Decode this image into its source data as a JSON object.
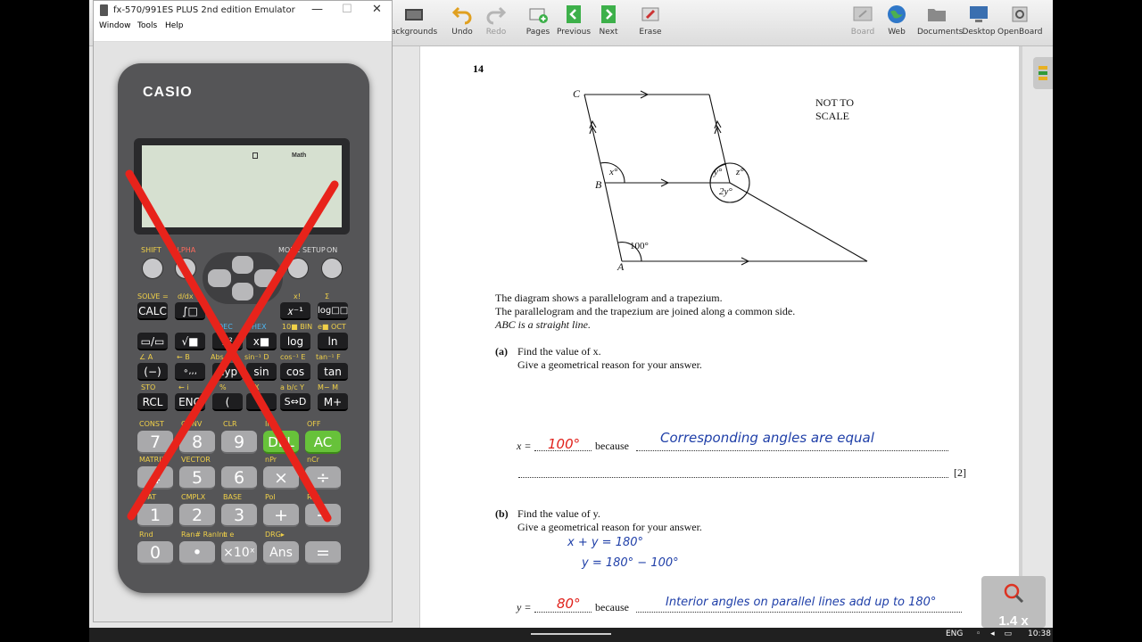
{
  "toolbar": {
    "left_items": [
      {
        "label": "ackgrounds",
        "icon": "backgrounds-icon"
      },
      {
        "label": "Undo",
        "icon": "undo-icon"
      },
      {
        "label": "Redo",
        "icon": "redo-icon"
      },
      {
        "label": "Pages",
        "icon": "pages-icon"
      },
      {
        "label": "Previous",
        "icon": "previous-icon"
      },
      {
        "label": "Next",
        "icon": "next-icon"
      },
      {
        "label": "Erase",
        "icon": "erase-icon"
      }
    ],
    "right_items": [
      {
        "label": "Board",
        "icon": "board-icon"
      },
      {
        "label": "Web",
        "icon": "web-icon"
      },
      {
        "label": "Documents",
        "icon": "documents-icon"
      },
      {
        "label": "Desktop",
        "icon": "desktop-icon"
      },
      {
        "label": "OpenBoard",
        "icon": "openboard-icon"
      }
    ]
  },
  "emulator": {
    "title": "fx-570/991ES PLUS 2nd edition Emulator",
    "menu": [
      "Window",
      "Tools",
      "Help"
    ],
    "brand": "CASIO",
    "lcd_indicator": "Math",
    "top_labels": {
      "shift": "SHIFT",
      "alpha": "ALPHA",
      "mode": "MODE SETUP",
      "on": "ON"
    },
    "row1_keys": [
      "CALC",
      "∫□",
      "",
      "",
      "𝑥⁻¹",
      "log□□"
    ],
    "row1_labels": [
      "SOLVE =",
      "d/dx",
      "",
      "",
      "x!",
      "Σ"
    ],
    "row2_keys": [
      "▭/▭",
      "√■",
      "x²",
      "",
      "x■",
      "log",
      "ln"
    ],
    "row2_labels": [
      "",
      "",
      "DEC",
      "HEX",
      "10■ BIN",
      "e■ OCT"
    ],
    "row3_keys": [
      "(−)",
      "∘,,,",
      "hyp",
      "sin",
      "cos",
      "tan"
    ],
    "row3_labels": [
      "∠ A",
      "← B",
      "Abs C",
      "sin⁻¹ D",
      "cos⁻¹ E",
      "tan⁻¹ F"
    ],
    "row4_keys": [
      "RCL",
      "ENG",
      "(",
      ")",
      "S⇔D",
      "M+"
    ],
    "row4_labels": [
      "STO",
      "← i",
      "%",
      ", X",
      "a b/c Y",
      "M− M"
    ],
    "num_rows": [
      {
        "labels": [
          "CONST",
          "CONV",
          "CLR",
          "INS",
          "OFF"
        ],
        "keys": [
          "7",
          "8",
          "9",
          "DEL",
          "AC"
        ]
      },
      {
        "labels": [
          "MATRIX",
          "VECTOR",
          "",
          "nPr",
          "nCr"
        ],
        "keys": [
          "4",
          "5",
          "6",
          "×",
          "÷"
        ]
      },
      {
        "labels": [
          "STAT",
          "CMPLX",
          "BASE",
          "Pol",
          "Rec"
        ],
        "keys": [
          "1",
          "2",
          "3",
          "+",
          "−"
        ]
      },
      {
        "labels": [
          "Rnd",
          "Ran# RanInt",
          "π e",
          "DRG▸",
          ""
        ],
        "keys": [
          "0",
          "•",
          "×10ˣ",
          "Ans",
          "="
        ]
      }
    ]
  },
  "paper": {
    "question_number": "14",
    "not_to_scale": [
      "NOT TO",
      "SCALE"
    ],
    "labels": {
      "c": "C",
      "b": "B",
      "a": "A",
      "x": "x°",
      "y": "y°",
      "z": "z°",
      "two_y": "2y°",
      "hundred": "100°"
    },
    "intro": [
      "The diagram shows a parallelogram and a trapezium.",
      "The parallelogram and the trapezium are joined along a common side.",
      "ABC is a straight line."
    ],
    "part_a": {
      "tag": "(a)",
      "lines": [
        "Find the value of x.",
        "Give a geometrical reason for your answer."
      ],
      "answer_prefix": "x = ",
      "answer_value": "100°",
      "because": "because",
      "reason": "Corresponding angles are equal",
      "marks": "[2]"
    },
    "part_b": {
      "tag": "(b)",
      "lines": [
        "Find the value of y.",
        "Give a geometrical reason for your answer."
      ],
      "working": [
        "x + y = 180°",
        "y = 180° − 100°"
      ],
      "answer_prefix": "y = ",
      "answer_value": "80°",
      "because": "because",
      "reason": "Interior angles on parallel lines add up to 180°"
    }
  },
  "zoom": "1.4 x",
  "taskbar": {
    "lang": "ENG",
    "time": "10:38"
  },
  "colors": {
    "pen_blue": "#1f3fa8",
    "pen_red": "#e0201a",
    "cross_red": "#e8231b",
    "calc_body": "#555557",
    "green_key": "#67c23a"
  }
}
